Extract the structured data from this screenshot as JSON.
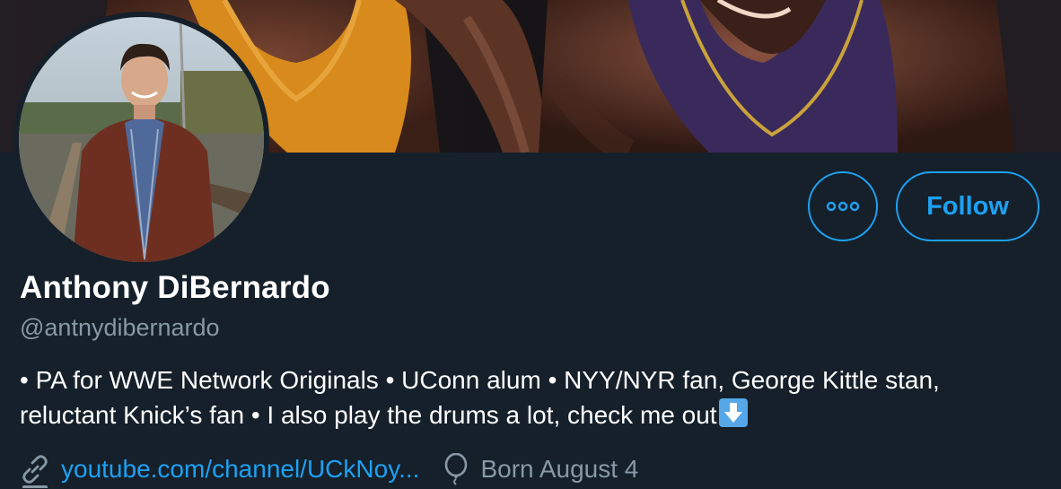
{
  "profile": {
    "name": "Anthony DiBernardo",
    "handle": "@antnydibernardo",
    "bio_line1": "• PA for WWE Network Originals • UConn alum • NYY/NYR fan, George Kittle stan,",
    "bio_line2": "reluctant Knick’s fan • I also play the drums a lot, check me out",
    "website": "youtube.com/channel/UCkNoy...",
    "birthday": "Born August 4"
  },
  "actions": {
    "more_icon": "more-dots-icon",
    "follow_label": "Follow"
  },
  "icons": {
    "link": "link-icon",
    "birthday": "balloon-icon",
    "emoji": "down-arrow-emoji"
  },
  "colors": {
    "background": "#15202b",
    "accent": "#1da1f2",
    "secondary_text": "#8899a6",
    "primary_text": "#ffffff"
  }
}
